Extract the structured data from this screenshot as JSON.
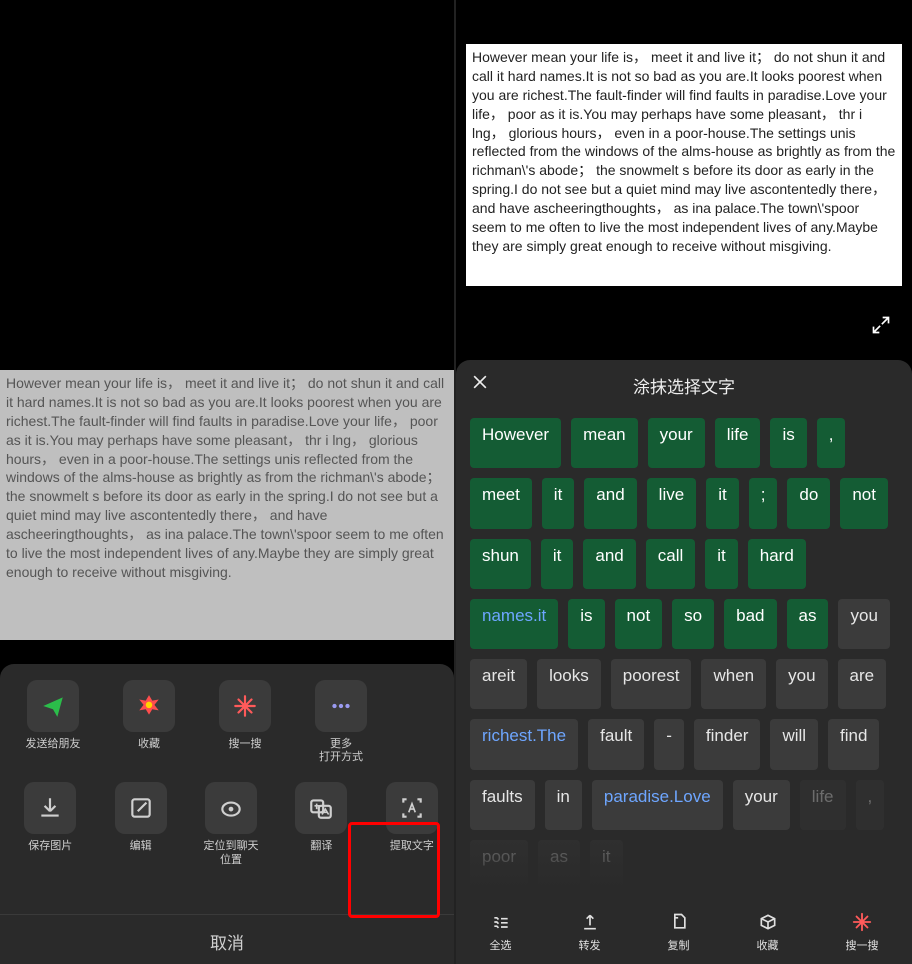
{
  "paragraph": "However mean your life is， meet it and live it； do not shun it and call it hard names.It is not so bad as you are.It looks poorest when you are richest.The fault-finder will find faults in paradise.Love your life， poor as it is.You may perhaps have some pleasant， thr i lng， glorious hours， even in a poor-house.The settings unis reflected from the windows of the alms-house as brightly as from the richman\\'s abode； the snowmelt s before its door as early in the spring.I do not see but a quiet mind may live ascontentedly there， and have ascheeringthoughts， as ina palace.The town\\'spoor seem to me often to live the most independent lives of any.Maybe they are simply great enough to receive without misgiving.",
  "left": {
    "row1": [
      {
        "name": "share-icon",
        "label": "发送给朋友"
      },
      {
        "name": "favorite-icon",
        "label": "收藏"
      },
      {
        "name": "search-icon",
        "label": "搜一搜"
      },
      {
        "name": "more-icon",
        "label": "更多\n打开方式"
      }
    ],
    "row2": [
      {
        "name": "download-icon",
        "label": "保存图片"
      },
      {
        "name": "edit-icon",
        "label": "编辑"
      },
      {
        "name": "locate-icon",
        "label": "定位到聊天\n位置"
      },
      {
        "name": "translate-icon",
        "label": "翻译"
      },
      {
        "name": "ocr-icon",
        "label": "提取文字"
      }
    ],
    "cancel": "取消"
  },
  "right": {
    "title": "涂抹选择文字",
    "chips": [
      {
        "t": "However",
        "s": true
      },
      {
        "t": "mean",
        "s": true
      },
      {
        "t": "your",
        "s": true
      },
      {
        "t": "life",
        "s": true
      },
      {
        "t": "is",
        "s": true
      },
      {
        "t": ",",
        "s": true
      },
      {
        "t": "meet",
        "s": true
      },
      {
        "t": "it",
        "s": true
      },
      {
        "t": "and",
        "s": true
      },
      {
        "t": "live",
        "s": true
      },
      {
        "t": "it",
        "s": true
      },
      {
        "t": ";",
        "s": true
      },
      {
        "t": "do",
        "s": true
      },
      {
        "t": "not",
        "s": true
      },
      {
        "t": "shun",
        "s": true
      },
      {
        "t": "it",
        "s": true
      },
      {
        "t": "and",
        "s": true
      },
      {
        "t": "call",
        "s": true
      },
      {
        "t": "it",
        "s": true
      },
      {
        "t": "hard",
        "s": true
      },
      {
        "t": "names.it",
        "s": true,
        "link": true
      },
      {
        "t": "is",
        "s": true
      },
      {
        "t": "not",
        "s": true
      },
      {
        "t": "so",
        "s": true
      },
      {
        "t": "bad",
        "s": true
      },
      {
        "t": "as",
        "s": true
      },
      {
        "t": "you"
      },
      {
        "t": "areit"
      },
      {
        "t": "looks"
      },
      {
        "t": "poorest"
      },
      {
        "t": "when"
      },
      {
        "t": "you"
      },
      {
        "t": "are"
      },
      {
        "t": "richest.The",
        "link": true
      },
      {
        "t": "fault"
      },
      {
        "t": "-"
      },
      {
        "t": "finder"
      },
      {
        "t": "will"
      },
      {
        "t": "find"
      },
      {
        "t": "faults"
      },
      {
        "t": "in"
      },
      {
        "t": "paradise.Love",
        "link": true
      },
      {
        "t": "your"
      },
      {
        "t": "life",
        "fade": true
      },
      {
        "t": ",",
        "fade": true
      },
      {
        "t": "poor",
        "fade": true
      },
      {
        "t": "as",
        "fade": true
      },
      {
        "t": "it",
        "fade": true
      }
    ],
    "toolbar": [
      {
        "name": "select-all-icon",
        "label": "全选"
      },
      {
        "name": "forward-icon",
        "label": "转发"
      },
      {
        "name": "copy-icon",
        "label": "复制"
      },
      {
        "name": "collect-icon",
        "label": "收藏"
      },
      {
        "name": "search-icon",
        "label": "搜一搜"
      }
    ]
  }
}
